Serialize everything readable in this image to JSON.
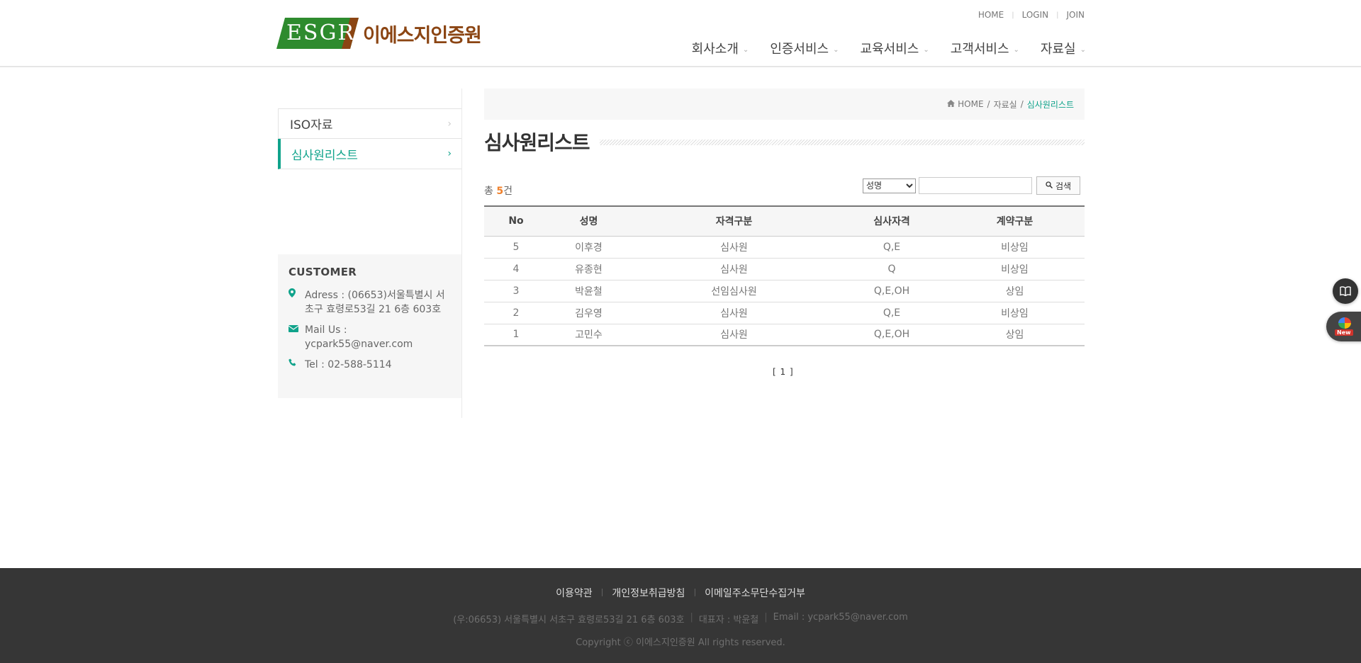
{
  "header": {
    "logo_en": "ESGR",
    "logo_ko": "이에스지인증원",
    "top_links": [
      "HOME",
      "LOGIN",
      "JOIN"
    ],
    "menu": [
      "회사소개",
      "인증서비스",
      "교육서비스",
      "고객서비스",
      "자료실"
    ]
  },
  "sidebar": {
    "items": [
      {
        "label": "ISO자료",
        "active": false
      },
      {
        "label": "심사원리스트",
        "active": true
      }
    ]
  },
  "customer": {
    "title": "CUSTOMER",
    "address": "Adress : (06653)서울특별시 서초구 효령로53길 21 6층 603호",
    "mail": "Mail Us : ycpark55@naver.com",
    "tel": "Tel : 02-588-5114"
  },
  "breadcrumb": {
    "home": "HOME",
    "parent": "자료실",
    "current": "심사원리스트"
  },
  "page": {
    "title": "심사원리스트",
    "total_prefix": "총",
    "total_count": "5",
    "total_suffix": "건"
  },
  "search": {
    "selected_option": "성명",
    "input_value": "",
    "button_label": "검색"
  },
  "table": {
    "headers": [
      "No",
      "성명",
      "자격구분",
      "심사자격",
      "계약구분"
    ],
    "rows": [
      [
        "5",
        "이후경",
        "심사원",
        "Q,E",
        "비상임"
      ],
      [
        "4",
        "유종현",
        "심사원",
        "Q",
        "비상임"
      ],
      [
        "3",
        "박윤철",
        "선임심사원",
        "Q,E,OH",
        "상임"
      ],
      [
        "2",
        "김우영",
        "심사원",
        "Q,E",
        "비상임"
      ],
      [
        "1",
        "고민수",
        "심사원",
        "Q,E,OH",
        "상임"
      ]
    ]
  },
  "pager": "[ 1 ]",
  "floating": {
    "new_badge": "New"
  },
  "footer": {
    "links": [
      "이용약관",
      "개인정보취급방침",
      "이메일주소무단수집거부"
    ],
    "address": "(우:06653) 서울특별시 서초구 효령로53길 21 6층 603호",
    "ceo": "대표자 : 박윤철",
    "email": "Email : ycpark55@naver.com",
    "copyright": "Copyright ⓒ 이에스지인증원 All rights reserved."
  },
  "colors": {
    "accent": "#10a38b",
    "logo_green": "#2e8b2e",
    "logo_brown": "#8b4513",
    "count": "#f0812c",
    "footer_bg": "#363636"
  }
}
